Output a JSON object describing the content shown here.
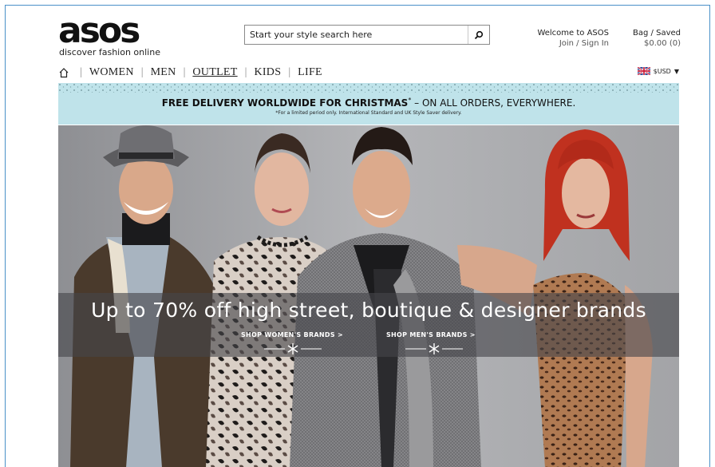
{
  "brand": {
    "logo_text": "asos",
    "tagline": "discover fashion online"
  },
  "search": {
    "placeholder": "Start your style search here"
  },
  "account": {
    "welcome": "Welcome to ASOS",
    "join_sign_in": "Join / Sign In"
  },
  "bag": {
    "label": "Bag / Saved",
    "summary": "$0.00 (0)"
  },
  "nav": {
    "items": [
      {
        "label": "WOMEN"
      },
      {
        "label": "MEN"
      },
      {
        "label": "OUTLET"
      },
      {
        "label": "KIDS"
      },
      {
        "label": "LIFE"
      }
    ],
    "active": "OUTLET"
  },
  "currency": {
    "label": "$USD"
  },
  "banner": {
    "bold_text": "FREE DELIVERY WORLDWIDE FOR CHRISTMAS",
    "asterisk": "*",
    "rest_text": " – ON ALL ORDERS, EVERYWHERE.",
    "fine_print": "*For a limited period only. International Standard and UK Style Saver delivery."
  },
  "hero": {
    "headline": "Up to 70% off high street, boutique & designer brands",
    "shop_womens": "SHOP WOMEN'S BRANDS >",
    "shop_mens": "SHOP MEN'S BRANDS >"
  },
  "colors": {
    "frame_border": "#4a90c8",
    "banner_bg": "#bfe3ea",
    "hero_bg": "#9e9fa3",
    "text": "#111111"
  },
  "icons": {
    "home": "home-icon",
    "search": "search-icon",
    "flag": "uk-flag-icon",
    "dropdown": "caret-down-icon",
    "snowflake": "snowflake-icon"
  }
}
